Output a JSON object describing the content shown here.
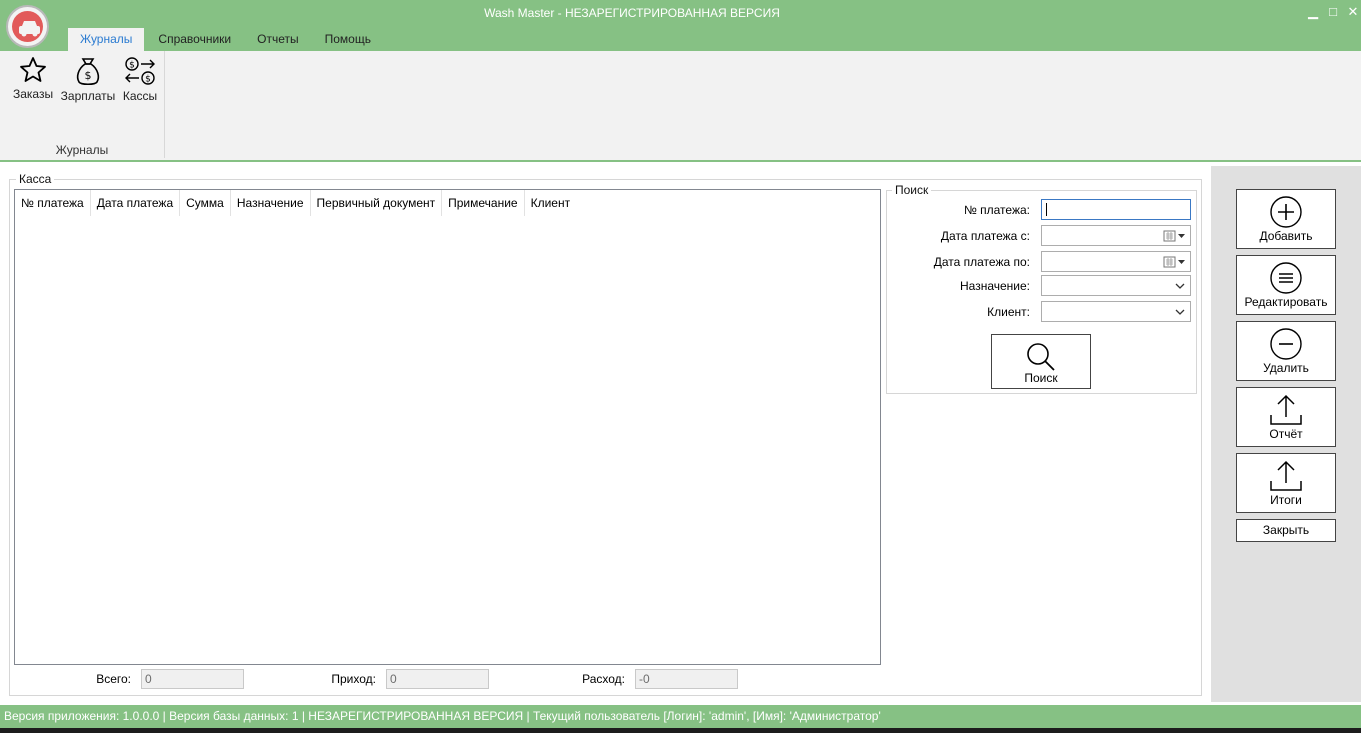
{
  "window": {
    "title": "Wash Master - НЕЗАРЕГИСТРИРОВАННАЯ ВЕРСИЯ",
    "controls": {
      "minimize": "▁",
      "maximize": "□",
      "close": "✕"
    }
  },
  "menu": {
    "tabs": [
      {
        "label": "Журналы",
        "active": true
      },
      {
        "label": "Справочники",
        "active": false
      },
      {
        "label": "Отчеты",
        "active": false
      },
      {
        "label": "Помощь",
        "active": false
      }
    ]
  },
  "ribbon": {
    "buttons": [
      {
        "label": "Заказы",
        "icon": "star-icon"
      },
      {
        "label": "Зарплаты",
        "icon": "money-bag-icon"
      },
      {
        "label": "Кассы",
        "icon": "currency-exchange-icon"
      }
    ],
    "group_label": "Журналы"
  },
  "kassa": {
    "legend": "Касса",
    "columns": [
      "№ платежа",
      "Дата платежа",
      "Сумма",
      "Назначение",
      "Первичный документ",
      "Примечание",
      "Клиент"
    ],
    "rows": []
  },
  "summary": {
    "total_label": "Всего:",
    "total_value": "0",
    "income_label": "Приход:",
    "income_value": "0",
    "expense_label": "Расход:",
    "expense_value": "-0"
  },
  "search": {
    "legend": "Поиск",
    "payment_no_label": "№ платежа:",
    "payment_no_value": "",
    "date_from_label": "Дата платежа с:",
    "date_from_value": "",
    "date_to_label": "Дата платежа по:",
    "date_to_value": "",
    "purpose_label": "Назначение:",
    "purpose_value": "",
    "client_label": "Клиент:",
    "client_value": "",
    "search_button": "Поиск"
  },
  "actions": {
    "add": "Добавить",
    "edit": "Редактировать",
    "delete": "Удалить",
    "report": "Отчёт",
    "totals": "Итоги",
    "close": "Закрыть"
  },
  "status": {
    "text": "Версия приложения: 1.0.0.0 | Версия базы данных: 1 | НЕЗАРЕГИСТРИРОВАННАЯ ВЕРСИЯ | Текущий пользователь [Логин]: 'admin', [Имя]: 'Администратор'"
  },
  "colors": {
    "accent_green": "#86c184",
    "active_tab_text": "#2b7bd1",
    "logo_red": "#e25a5a"
  }
}
